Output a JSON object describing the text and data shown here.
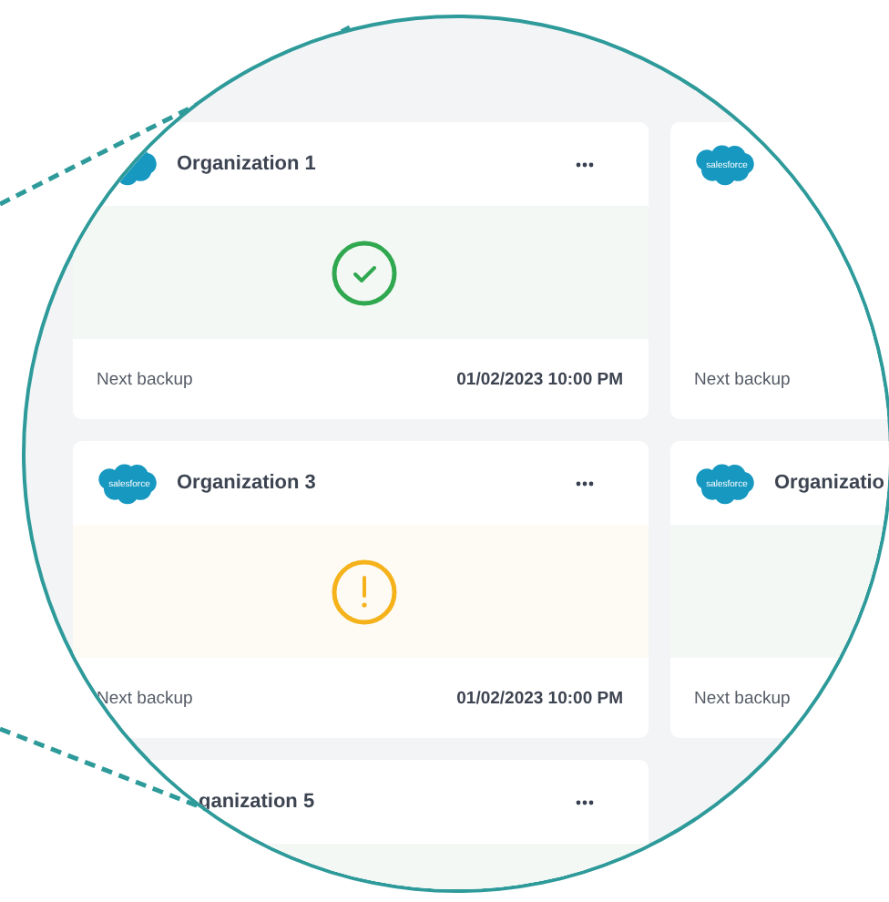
{
  "cards": [
    {
      "title": "Organization 1",
      "logo": true,
      "kind": "success",
      "footer_label": "Next backup",
      "footer_value": "01/02/2023 10:00 PM"
    },
    {
      "logo": true,
      "logo_text": "salesforce",
      "kind": "plain",
      "footer_label": "Next backup"
    },
    {
      "title": "Organization 3",
      "logo": true,
      "logo_text": "salesforce",
      "kind": "warning",
      "footer_label": "Next backup",
      "footer_value": "01/02/2023 10:00 PM"
    },
    {
      "title": "Organizatio",
      "logo": true,
      "logo_text": "salesforce",
      "kind": "success_tint",
      "footer_label": "Next backup"
    },
    {
      "title": "ganization 5",
      "logo": false,
      "kind": "success_tint"
    }
  ]
}
